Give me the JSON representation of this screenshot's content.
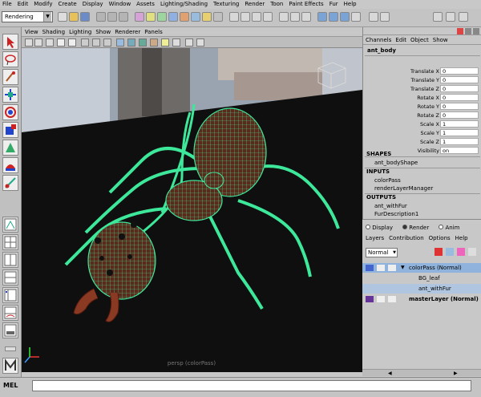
{
  "menubar": {
    "items": [
      "File",
      "Edit",
      "Modify",
      "Create",
      "Display",
      "Window",
      "Assets",
      "Lighting/Shading",
      "Texturing",
      "Render",
      "Toon",
      "Paint Effects",
      "Fur",
      "Help"
    ]
  },
  "status": {
    "mode": "Rendering"
  },
  "panel": {
    "menu": [
      "View",
      "Shading",
      "Lighting",
      "Show",
      "Renderer",
      "Panels"
    ],
    "camera_label": "persp (colorPass)"
  },
  "channels": {
    "tabs": [
      "Channels",
      "Edit",
      "Object",
      "Show"
    ],
    "object_name": "ant_body",
    "attributes": [
      {
        "label": "Translate X",
        "value": "0"
      },
      {
        "label": "Translate Y",
        "value": "0"
      },
      {
        "label": "Translate Z",
        "value": "0"
      },
      {
        "label": "Rotate X",
        "value": "0"
      },
      {
        "label": "Rotate Y",
        "value": "0"
      },
      {
        "label": "Rotate Z",
        "value": "0"
      },
      {
        "label": "Scale X",
        "value": "1"
      },
      {
        "label": "Scale Y",
        "value": "1"
      },
      {
        "label": "Scale Z",
        "value": "1"
      },
      {
        "label": "Visibility",
        "value": "on"
      }
    ],
    "shapes_header": "SHAPES",
    "shapes": [
      "ant_bodyShape"
    ],
    "inputs_header": "INPUTS",
    "inputs": [
      "colorPass",
      "renderLayerManager"
    ],
    "outputs_header": "OUTPUTS",
    "outputs": [
      "ant_withFur",
      "FurDescription1"
    ]
  },
  "layers": {
    "radios": [
      "Display",
      "Render",
      "Anim"
    ],
    "menu": [
      "Layers",
      "Contribution",
      "Options",
      "Help"
    ],
    "blend_mode": "Normal",
    "rows": [
      {
        "name": "colorPass (Normal)"
      },
      {
        "name": "BG_leaf"
      },
      {
        "name": "ant_withFur"
      },
      {
        "name": "masterLayer (Normal)"
      }
    ]
  },
  "cmdline": {
    "label": "MEL"
  },
  "colors": {
    "wire": "#3ee89a",
    "accent": "#6aa0e0"
  }
}
